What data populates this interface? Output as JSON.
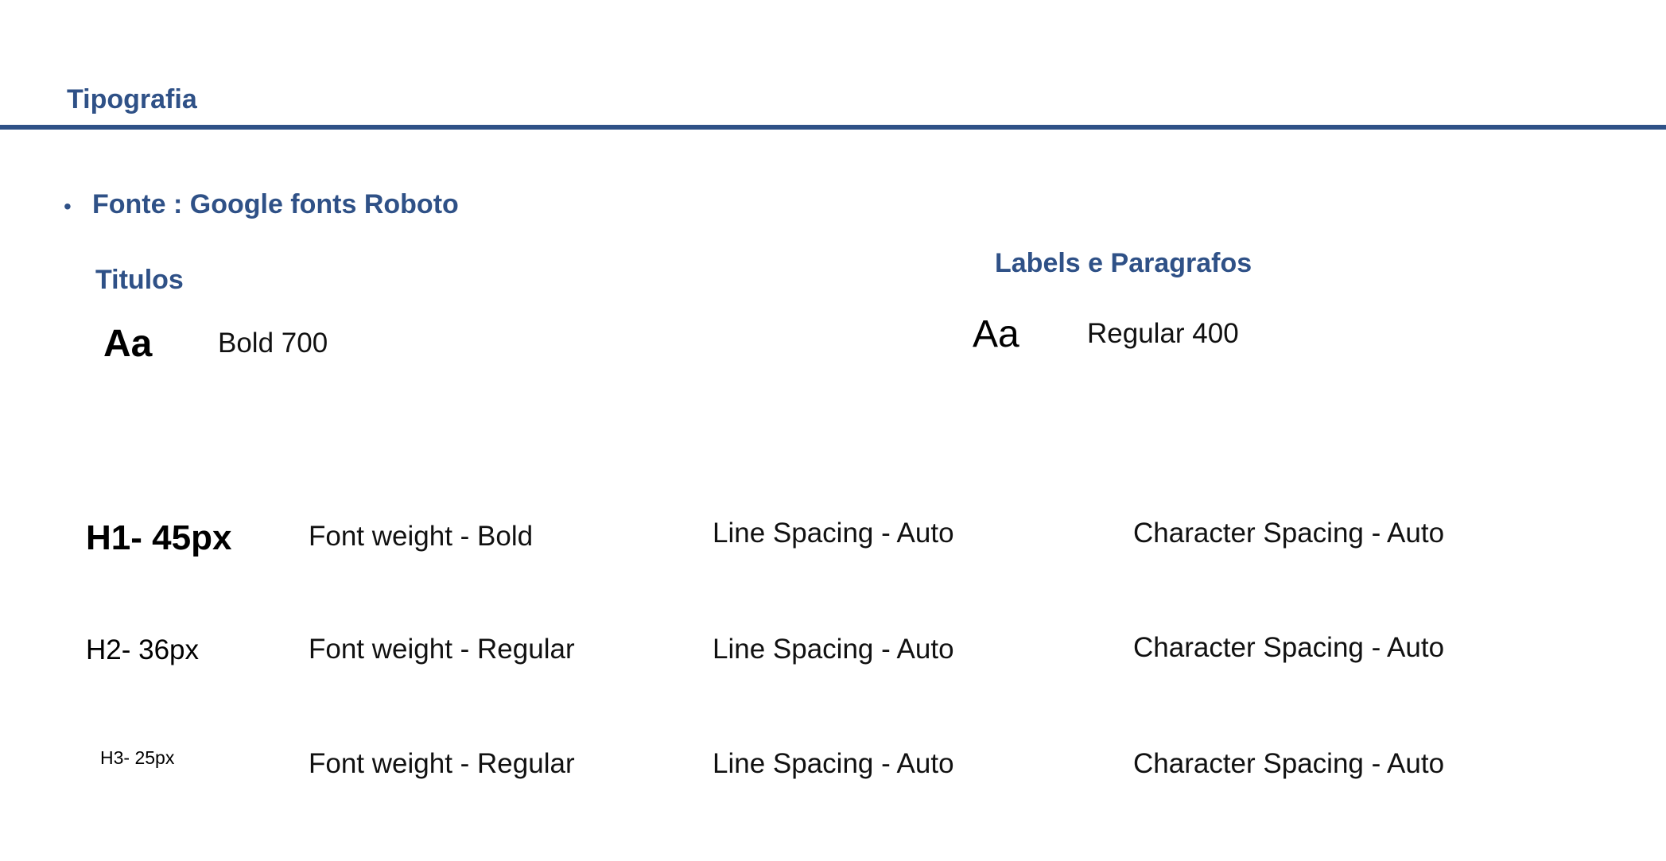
{
  "page": {
    "title": "Tipografia",
    "font_line": "Fonte : Google fonts Roboto",
    "bullet": "•"
  },
  "sections": {
    "titulos": {
      "heading": "Titulos",
      "sample": "Aa",
      "weight": "Bold 700"
    },
    "labels": {
      "heading": "Labels e Paragrafos",
      "sample": "Aa",
      "weight": "Regular 400"
    }
  },
  "specs": [
    {
      "name": "H1- 45px",
      "weight": "Font  weight - Bold",
      "line_spacing": "Line Spacing - Auto",
      "char_spacing": "Character Spacing - Auto"
    },
    {
      "name": "H2- 36px",
      "weight": "Font  weight - Regular",
      "line_spacing": "Line Spacing - Auto",
      "char_spacing": "Character Spacing - Auto"
    },
    {
      "name": "H3- 25px",
      "weight": "Font  weight - Regular",
      "line_spacing": "Line Spacing - Auto",
      "char_spacing": "Character Spacing - Auto"
    }
  ],
  "colors": {
    "accent": "#2f5187",
    "text": "#111111",
    "background": "#ffffff"
  }
}
